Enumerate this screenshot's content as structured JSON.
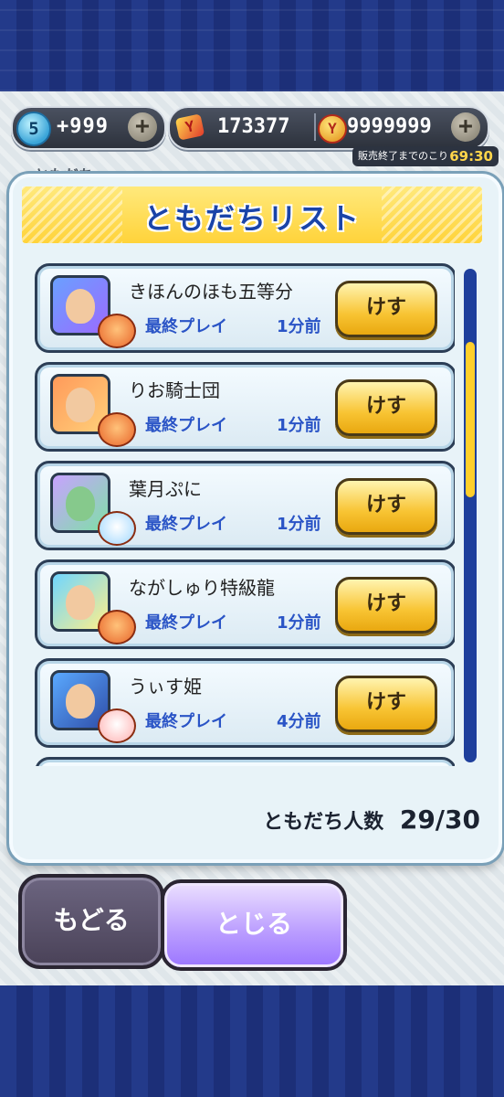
{
  "currency": {
    "stamina": "5",
    "gems": "+999",
    "plus": "+",
    "money1": "173377",
    "money2": "9999999",
    "sale_label": "販売終了までのこり",
    "sale_time": "69:30",
    "behind_title": "ともだち"
  },
  "panel": {
    "title": "ともだちリスト"
  },
  "friends": [
    {
      "name": "きほんのほも五等分",
      "label": "最終プレイ",
      "time": "1分前",
      "button": "けす"
    },
    {
      "name": "りお騎士団",
      "label": "最終プレイ",
      "time": "1分前",
      "button": "けす"
    },
    {
      "name": "葉月ぷに",
      "label": "最終プレイ",
      "time": "1分前",
      "button": "けす"
    },
    {
      "name": "ながしゅり特級龍",
      "label": "最終プレイ",
      "time": "1分前",
      "button": "けす"
    },
    {
      "name": "うぃす姫",
      "label": "最終プレイ",
      "time": "4分前",
      "button": "けす"
    }
  ],
  "friend_count": {
    "label": "ともだち人数",
    "value": "29/30"
  },
  "buttons": {
    "back": "もどる",
    "close": "とじる"
  }
}
